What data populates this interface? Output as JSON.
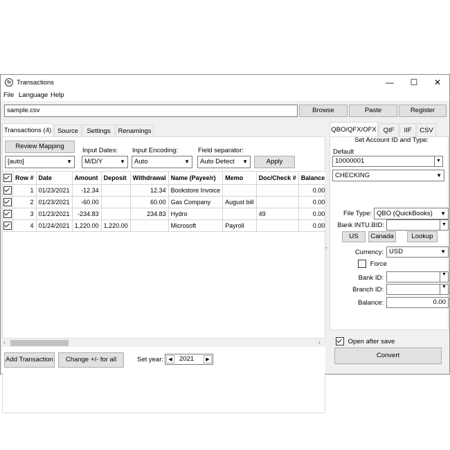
{
  "window": {
    "title": "Transactions",
    "icon_text": "Tr",
    "minimize": "—",
    "maximize": "☐",
    "close": "✕"
  },
  "menu": [
    "File",
    "Language",
    "Help"
  ],
  "file": {
    "path": "sample.csv",
    "browse": "Browse",
    "paste": "Paste",
    "register": "Register"
  },
  "left_tabs": [
    {
      "label": "Transactions (4)",
      "active": true
    },
    {
      "label": "Source",
      "active": false
    },
    {
      "label": "Settings",
      "active": false
    },
    {
      "label": "Renamings",
      "active": false
    }
  ],
  "options": {
    "review_mapping": "Review Mapping",
    "mapping_value": "[auto]",
    "input_dates_label": "Input Dates:",
    "input_dates_value": "M/D/Y",
    "input_encoding_label": "Input Encoding:",
    "input_encoding_value": "Auto",
    "field_separator_label": "Field separator:",
    "field_separator_value": "Auto Detect",
    "apply": "Apply"
  },
  "table": {
    "columns": [
      "",
      "Row #",
      "Date",
      "Amount",
      "Deposit",
      "Withdrawal",
      "Name (Payee/r)",
      "Memo",
      "Doc/Check #",
      "Balance"
    ],
    "rows": [
      {
        "checked": true,
        "row": "1",
        "date": "01/23/2021",
        "amount": "-12.34",
        "deposit": "",
        "withdrawal": "12.34",
        "name": "Bookstore Invoice",
        "memo": "",
        "doc": "",
        "balance": "0.00"
      },
      {
        "checked": true,
        "row": "2",
        "date": "01/23/2021",
        "amount": "-60.00",
        "deposit": "",
        "withdrawal": "60.00",
        "name": "Gas Company",
        "memo": "August bill",
        "doc": "",
        "balance": "0.00"
      },
      {
        "checked": true,
        "row": "3",
        "date": "01/23/2021",
        "amount": "-234.83",
        "deposit": "",
        "withdrawal": "234.83",
        "name": "Hydro",
        "memo": "",
        "doc": "49",
        "balance": "0.00"
      },
      {
        "checked": true,
        "row": "4",
        "date": "01/24/2021",
        "amount": "1,220.00",
        "deposit": "1,220.00",
        "withdrawal": "",
        "name": "Microsoft",
        "memo": "Payroll",
        "doc": "",
        "balance": "0.00"
      }
    ]
  },
  "bottom": {
    "add_transaction": "Add Transaction",
    "change_sign": "Change +/- for all",
    "set_year_label": "Set year:",
    "year": "2021"
  },
  "right_tabs": [
    {
      "label": "QBO/QFX/OFX",
      "active": true
    },
    {
      "label": "QIF",
      "active": false
    },
    {
      "label": "IIF",
      "active": false
    },
    {
      "label": "CSV",
      "active": false
    }
  ],
  "right": {
    "heading": "Set Account ID and Type:",
    "default_label": "Default",
    "account_id": "10000001",
    "account_type": "CHECKING",
    "file_type_label": "File Type:",
    "file_type_value": "QBO (QuickBooks)",
    "bank_intu_label": "Bank INTU.BID:",
    "bank_intu_value": "",
    "us": "US",
    "canada": "Canada",
    "lookup": "Lookup",
    "currency_label": "Currency:",
    "currency_value": "USD",
    "force_label": "Force",
    "bank_id_label": "Bank ID:",
    "branch_id_label": "Branch ID:",
    "balance_label": "Balance:",
    "balance_value": "0.00",
    "open_after_save": "Open after save",
    "convert": "Convert"
  },
  "icons": [
    "app-icon",
    "dropdown-arrow-icon",
    "checkbox-icon",
    "left-arrow-icon",
    "right-arrow-icon",
    "splitter-handle-icon"
  ]
}
